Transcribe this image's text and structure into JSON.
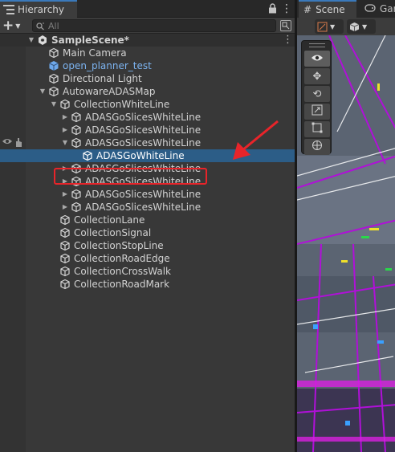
{
  "hierarchy": {
    "tab_label": "Hierarchy",
    "search": {
      "placeholder": "All",
      "value": ""
    },
    "add_label": "+",
    "rows": [
      {
        "label": "SampleScene*",
        "kind": "scene"
      },
      {
        "label": "Main Camera",
        "kind": "object"
      },
      {
        "label": "open_planner_test",
        "kind": "prefab"
      },
      {
        "label": "Directional Light",
        "kind": "object"
      },
      {
        "label": "AutowareADASMap",
        "kind": "object",
        "expanded": true
      },
      {
        "label": "CollectionWhiteLine",
        "kind": "object",
        "expanded": true
      },
      {
        "label": "ADASGoSlicesWhiteLine",
        "kind": "object",
        "expanded": false
      },
      {
        "label": "ADASGoSlicesWhiteLine",
        "kind": "object",
        "expanded": false
      },
      {
        "label": "ADASGoSlicesWhiteLine",
        "kind": "object",
        "expanded": true,
        "highlighted": true
      },
      {
        "label": "ADASGoWhiteLine",
        "kind": "object",
        "selected": true
      },
      {
        "label": "ADASGoSlicesWhiteLine",
        "kind": "object",
        "expanded": false
      },
      {
        "label": "ADASGoSlicesWhiteLine",
        "kind": "object",
        "expanded": false
      },
      {
        "label": "ADASGoSlicesWhiteLine",
        "kind": "object",
        "expanded": false
      },
      {
        "label": "ADASGoSlicesWhiteLine",
        "kind": "object",
        "expanded": false
      },
      {
        "label": "CollectionLane",
        "kind": "object"
      },
      {
        "label": "CollectionSignal",
        "kind": "object"
      },
      {
        "label": "CollectionStopLine",
        "kind": "object"
      },
      {
        "label": "CollectionRoadEdge",
        "kind": "object"
      },
      {
        "label": "CollectionCrossWalk",
        "kind": "object"
      },
      {
        "label": "CollectionRoadMark",
        "kind": "object"
      }
    ]
  },
  "scene": {
    "tab_label": "Scene",
    "game_tab_label": "Game",
    "tools": [
      "view-tool",
      "move-tool",
      "rotate-tool",
      "scale-tool",
      "rect-tool",
      "transform-tool"
    ]
  },
  "colors": {
    "selection": "#2c5d87",
    "annotation": "#e8242a",
    "prefab_text": "#7cb3f0",
    "tab_accent": "#3a79bb"
  }
}
